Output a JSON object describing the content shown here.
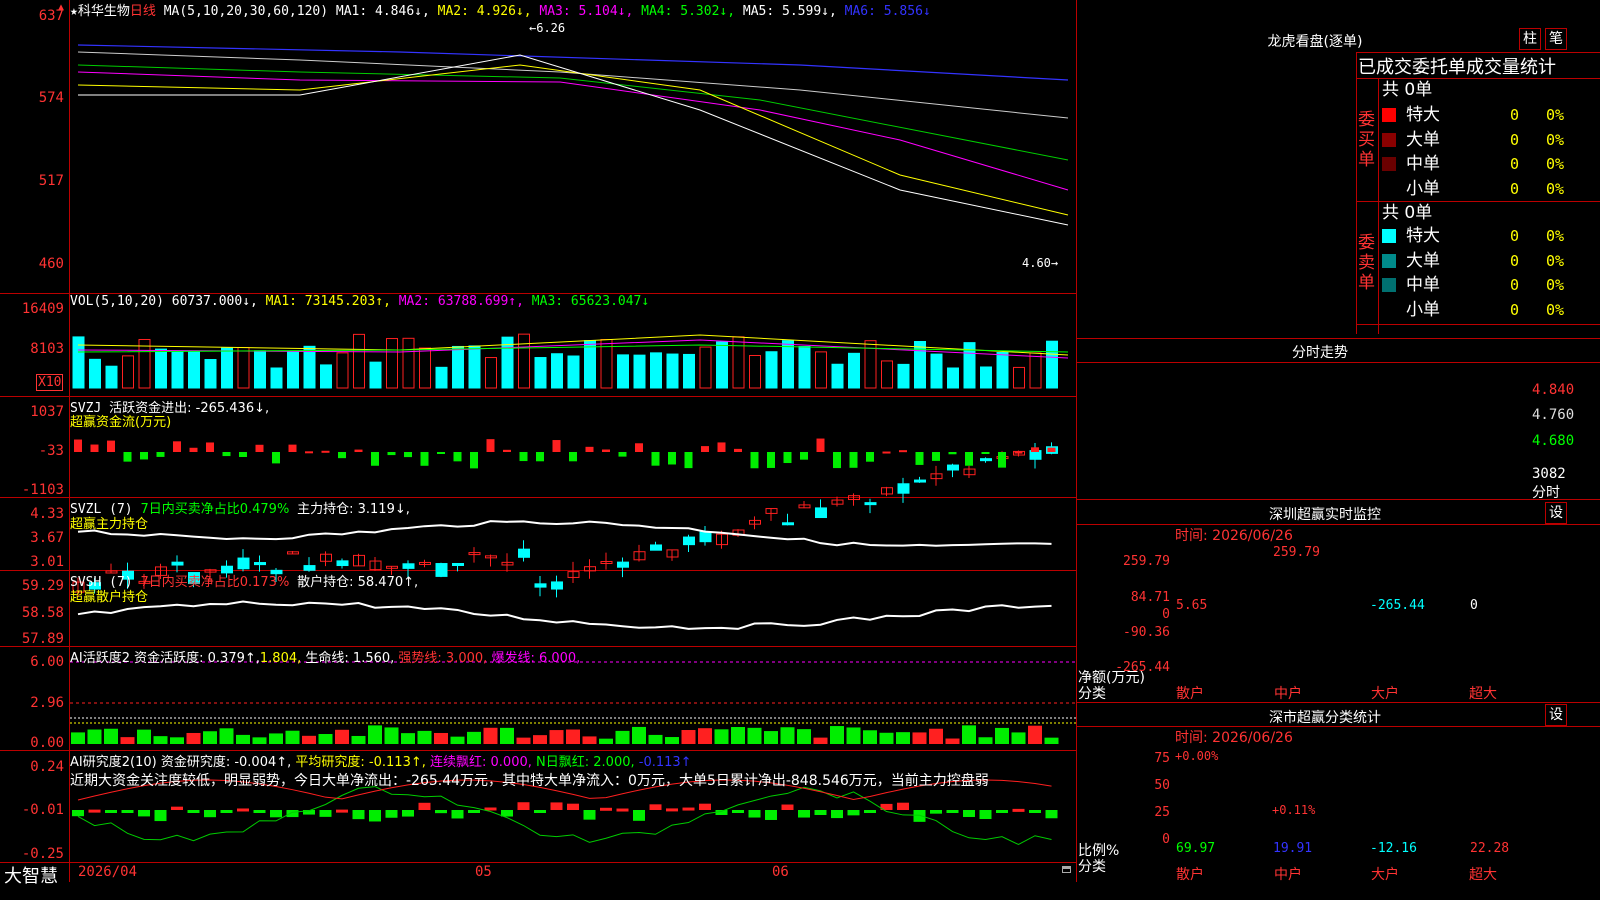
{
  "header": {
    "star": "★",
    "stock_name": "科华生物",
    "period": "日线",
    "ma_label": "MA(5,10,20,30,60,120)",
    "ma1": "MA1: 4.846↓,",
    "ma2": "MA2: 4.926↓,",
    "ma3": "MA3: 5.104↓,",
    "ma4": "MA4: 5.302↓,",
    "ma5": "MA5: 5.599↓,",
    "ma6": "MA6: 5.856↓"
  },
  "price_axis": [
    "637",
    "574",
    "517",
    "460"
  ],
  "price_high": "6.26",
  "price_low": "4.60",
  "vol": {
    "label": "VOL(5,10,20)",
    "value": "60737.000↓,",
    "ma1": "MA1: 73145.203↑,",
    "ma2": "MA2: 63788.699↑,",
    "ma3": "MA3: 65623.047↓",
    "axis": [
      "16409",
      "8103"
    ],
    "unit": "X10"
  },
  "svzj": {
    "label": "SVZJ",
    "line1": "活跃资金进出: -265.436↓,",
    "line2": "超赢资金流(万元)",
    "axis": [
      "1037",
      "-33",
      "-1103"
    ]
  },
  "svzl": {
    "label": "SVZL (7)",
    "ratio": "7日内买卖净占比0.479%",
    "hold": "主力持仓: 3.119↓,",
    "line2": "超赢主力持仓",
    "axis": [
      "4.33",
      "3.67",
      "3.01"
    ]
  },
  "svsh": {
    "label": "SVSH (7)",
    "ratio": "7日内买卖净占比0.173%",
    "hold": "散户持仓: 58.470↑,",
    "line2": "超赢散户持仓",
    "axis": [
      "59.29",
      "58.58",
      "57.89"
    ]
  },
  "ai1": {
    "label": "AI活跃度2",
    "a": "资金活跃度: 0.379↑,",
    "b": "1.804,",
    "c": "生命线: 1.560,",
    "d": "强势线: 3.000,",
    "e": "爆发线: 6.000,",
    "axis": [
      "6.00",
      "2.96",
      "0.00"
    ]
  },
  "ai2": {
    "label": "AI研究度2(10)",
    "a": "资金研究度: -0.004↑,",
    "b": "平均研究度: -0.113↑,",
    "c": "连续飘红: 0.000,",
    "d": "N日飘红: 2.000,",
    "e": "-0.113↑",
    "comment": "近期大资金关注度较低，明显弱势，今日大单净流出：-265.44万元，其中特大单净流入：0万元，大单5日累计净出-848.546万元，当前主力控盘弱",
    "axis": [
      "0.24",
      "-0.01",
      "-0.25"
    ]
  },
  "bottom": {
    "brand": "大智慧",
    "date_start": "2026/04",
    "month1": "05",
    "month2": "06"
  },
  "longhu": {
    "title": "龙虎看盘(逐单)",
    "btn1": "柱",
    "btn2": "笔",
    "subtitle": "已成交委托单成交量统计",
    "buy_side": "委买单",
    "sell_side": "委卖单",
    "buy_total": "共 0单",
    "sell_total": "共 0单",
    "buy_rows": [
      {
        "name": "特大",
        "v": "0",
        "p": "0%",
        "color": "#ff0000"
      },
      {
        "name": "大单",
        "v": "0",
        "p": "0%",
        "color": "#8a0000"
      },
      {
        "name": "中单",
        "v": "0",
        "p": "0%",
        "color": "#6a0000"
      },
      {
        "name": "小单",
        "v": "0",
        "p": "0%",
        "color": ""
      }
    ],
    "sell_rows": [
      {
        "name": "特大",
        "v": "0",
        "p": "0%",
        "color": "#00ffff"
      },
      {
        "name": "大单",
        "v": "0",
        "p": "0%",
        "color": "#008b8b"
      },
      {
        "name": "中单",
        "v": "0",
        "p": "0%",
        "color": "#007070"
      },
      {
        "name": "小单",
        "v": "0",
        "p": "0%",
        "color": ""
      }
    ]
  },
  "fenshi": {
    "title": "分时走势",
    "axis": [
      "4.840",
      "4.760",
      "4.680"
    ],
    "vol": "3082",
    "label": "分时"
  },
  "sz_monitor": {
    "title": "深圳超赢实时监控",
    "btn": "设",
    "time": "时间: 2026/06/26",
    "axis": [
      "259.79",
      "84.71",
      "0",
      "-90.36",
      "-265.44"
    ],
    "unit_a": "净额(万元)",
    "unit_b": "分类",
    "cats": [
      "散户",
      "中户",
      "大户",
      "超大"
    ],
    "values": [
      "5.65",
      "259.79",
      "-265.44",
      "0"
    ]
  },
  "sz_class": {
    "title": "深市超赢分类统计",
    "btn": "设",
    "time": "时间: 2026/06/26",
    "axis": [
      "75",
      "50",
      "25",
      "0"
    ],
    "unit_a": "比例%",
    "unit_b": "分类",
    "cats": [
      "散户",
      "中户",
      "大户",
      "超大"
    ],
    "values": [
      "69.97",
      "19.91",
      "-12.16",
      "22.28"
    ],
    "tops": [
      "+0.00%",
      "+0.11%"
    ]
  },
  "colors": {
    "up": "#ff2020",
    "down": "#00ffff",
    "grid": "#b00000"
  }
}
